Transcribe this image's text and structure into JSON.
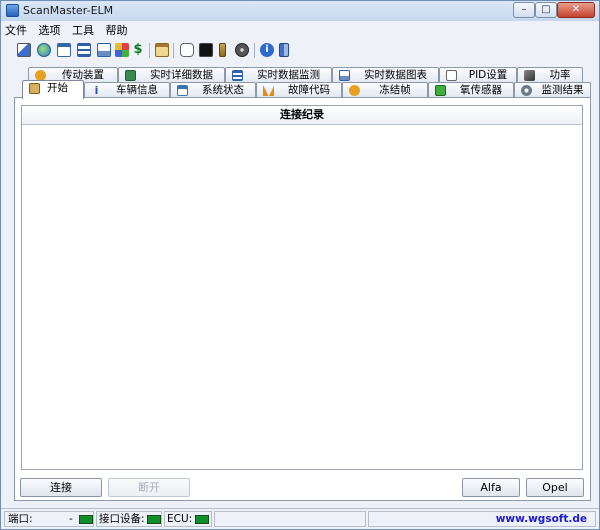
{
  "window": {
    "title": "ScanMaster-ELM",
    "minimize": "–",
    "maximize": "□",
    "close": "✕"
  },
  "menu": [
    "文件",
    "选项",
    "工具",
    "帮助"
  ],
  "toolbar_icons": [
    "wizard-icon",
    "globe-icon",
    "report-icon",
    "table-icon",
    "chart-icon",
    "palette-icon",
    "dollar-icon",
    "clipboard-icon",
    "chat-icon",
    "terminal-icon",
    "phone-icon",
    "disc-icon",
    "info-icon",
    "exit-icon"
  ],
  "tabs_row1": [
    {
      "label": "传动装置",
      "icon": "gear-icon"
    },
    {
      "label": "实时详细数据",
      "icon": "grid-icon"
    },
    {
      "label": "实时数据监测",
      "icon": "monitor-icon"
    },
    {
      "label": "实时数据图表",
      "icon": "chart-icon"
    },
    {
      "label": "PID设置",
      "icon": "document-icon"
    },
    {
      "label": "功率",
      "icon": "power-icon"
    }
  ],
  "tabs_row2": [
    {
      "label": "开始",
      "icon": "box-icon"
    },
    {
      "label": "车辆信息",
      "icon": "info-icon"
    },
    {
      "label": "系统状态",
      "icon": "checklist-icon"
    },
    {
      "label": "故障代码",
      "icon": "warning-icon"
    },
    {
      "label": "冻结帧",
      "icon": "snowflake-icon"
    },
    {
      "label": "氧传感器",
      "icon": "sensor-icon"
    },
    {
      "label": "监测结果",
      "icon": "cog-icon"
    }
  ],
  "log": {
    "header": "连接纪录"
  },
  "buttons": {
    "connect": "连接",
    "disconnect": "断开",
    "alfa": "Alfa",
    "opel": "Opel"
  },
  "status": {
    "port_label": "端口:",
    "port_value": "-",
    "interface_label": "接口设备:",
    "ecu_label": "ECU:",
    "website": "www.wgsoft.de"
  },
  "colors": {
    "led_green": "#0f8f2a",
    "link_blue": "#1b1bd8",
    "title_gradient": "#c5d7ef"
  }
}
